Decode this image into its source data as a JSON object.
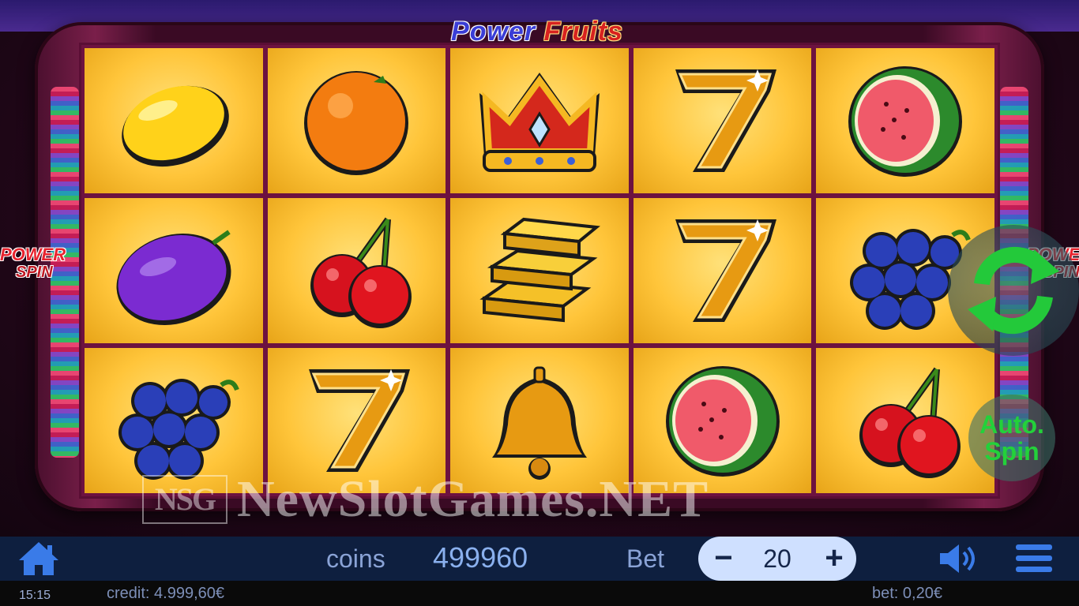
{
  "game": {
    "title_part1": "Power",
    "title_part2": "Fruits",
    "power_spin_line1": "POWER",
    "power_spin_line2": "SPIN"
  },
  "reels": [
    [
      "lemon",
      "orange",
      "crown",
      "seven",
      "watermelon"
    ],
    [
      "plum",
      "cherries",
      "gold-bars",
      "seven",
      "grapes"
    ],
    [
      "grapes",
      "seven",
      "bell",
      "watermelon",
      "cherries"
    ]
  ],
  "controls": {
    "auto_spin_line1": "Auto.",
    "auto_spin_line2": "Spin"
  },
  "watermark": {
    "logo": "NSG",
    "text": "NewSlotGames.NET"
  },
  "bottom_bar": {
    "coins_label": "coins",
    "coins_value": "499960",
    "bet_label": "Bet",
    "bet_minus": "−",
    "bet_value": "20",
    "bet_plus": "+"
  },
  "status_bar": {
    "time": "15:15",
    "credit": "credit: 4.999,60€",
    "bet": "bet: 0,20€"
  },
  "colors": {
    "accent_green": "#23d13a",
    "bar_background": "#0e1f3f",
    "cell_gold": "#ffc53a"
  },
  "icons": [
    "home-icon",
    "sound-icon",
    "menu-icon",
    "spin-refresh-icon"
  ]
}
